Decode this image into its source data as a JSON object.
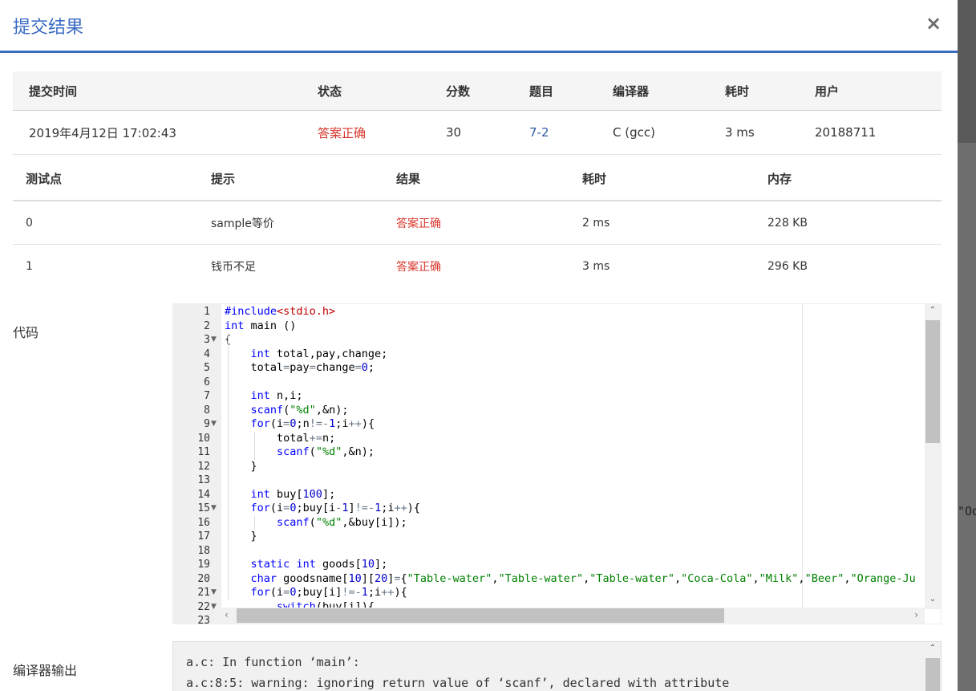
{
  "modal": {
    "title": "提交结果",
    "close": "×"
  },
  "backdrop": {
    "peek_text": "\"Oo"
  },
  "summary": {
    "headers": [
      "提交时间",
      "状态",
      "分数",
      "题目",
      "编译器",
      "耗时",
      "用户"
    ],
    "row": {
      "time": "2019年4月12日 17:02:43",
      "status": "答案正确",
      "score": "30",
      "problem": "7-2",
      "compiler": "C (gcc)",
      "duration": "3 ms",
      "user": "20188711"
    }
  },
  "tests": {
    "headers": [
      "测试点",
      "提示",
      "结果",
      "耗时",
      "内存"
    ],
    "rows": [
      {
        "id": "0",
        "hint": "sample等价",
        "result": "答案正确",
        "time": "2 ms",
        "memory": "228 KB"
      },
      {
        "id": "1",
        "hint": "钱币不足",
        "result": "答案正确",
        "time": "3 ms",
        "memory": "296 KB"
      }
    ]
  },
  "code": {
    "label": "代码",
    "lines": [
      "#include<stdio.h>",
      "int main ()",
      "{",
      "    int total,pay,change;",
      "    total=pay=change=0;",
      "",
      "    int n,i;",
      "    scanf(\"%d\",&n);",
      "    for(i=0;n!=-1;i++){",
      "        total+=n;",
      "        scanf(\"%d\",&n);",
      "    }",
      "",
      "    int buy[100];",
      "    for(i=0;buy[i-1]!=-1;i++){",
      "        scanf(\"%d\",&buy[i]);",
      "    }",
      "",
      "    static int goods[10];",
      "    char goodsname[10][20]={\"Table-water\",\"Table-water\",\"Table-water\",\"Coca-Cola\",\"Milk\",\"Beer\",\"Orange-Ju",
      "    for(i=0;buy[i]!=-1;i++){",
      "        switch(buy[i]){",
      ""
    ],
    "fold_lines": [
      3,
      9,
      15,
      21,
      22
    ]
  },
  "compiler_output": {
    "label": "编译器输出",
    "text": "a.c: In function ‘main’:\na.c:8:5: warning: ignoring return value of ‘scanf’, declared with attribute"
  }
}
